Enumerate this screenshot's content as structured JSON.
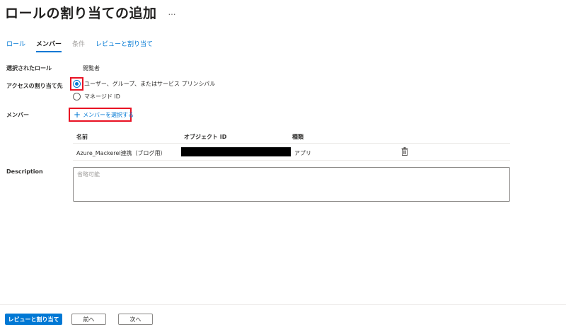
{
  "page": {
    "title": "ロールの割り当ての追加",
    "more_label": "…"
  },
  "tabs": [
    {
      "label": "ロール",
      "state": "default"
    },
    {
      "label": "メンバー",
      "state": "active"
    },
    {
      "label": "条件",
      "state": "disabled"
    },
    {
      "label": "レビューと割り当て",
      "state": "default"
    }
  ],
  "form": {
    "selected_role_label": "選択されたロール",
    "selected_role_value": "閲覧者",
    "assign_access_label": "アクセスの割り当て先",
    "assign_options": [
      {
        "label": "ユーザー、グループ、またはサービス プリンシパル",
        "checked": true
      },
      {
        "label": "マネージド ID",
        "checked": false
      }
    ],
    "members_label": "メンバー",
    "select_members_link": "メンバーを選択する",
    "members_table": {
      "columns": [
        "名前",
        "オブジェクト ID",
        "種類"
      ],
      "rows": [
        {
          "name": "Azure_Mackerel連携（ブログ用）",
          "object_id": "",
          "type": "アプリ"
        }
      ]
    },
    "description_label": "Description",
    "description_placeholder": "省略可能"
  },
  "footer": {
    "review_assign_button": "レビューと割り当て",
    "prev_button": "前へ",
    "next_button": "次へ"
  },
  "colors": {
    "accent": "#0078d4",
    "highlight": "#e81123"
  },
  "icons": [
    "plus-icon",
    "trash-icon"
  ]
}
